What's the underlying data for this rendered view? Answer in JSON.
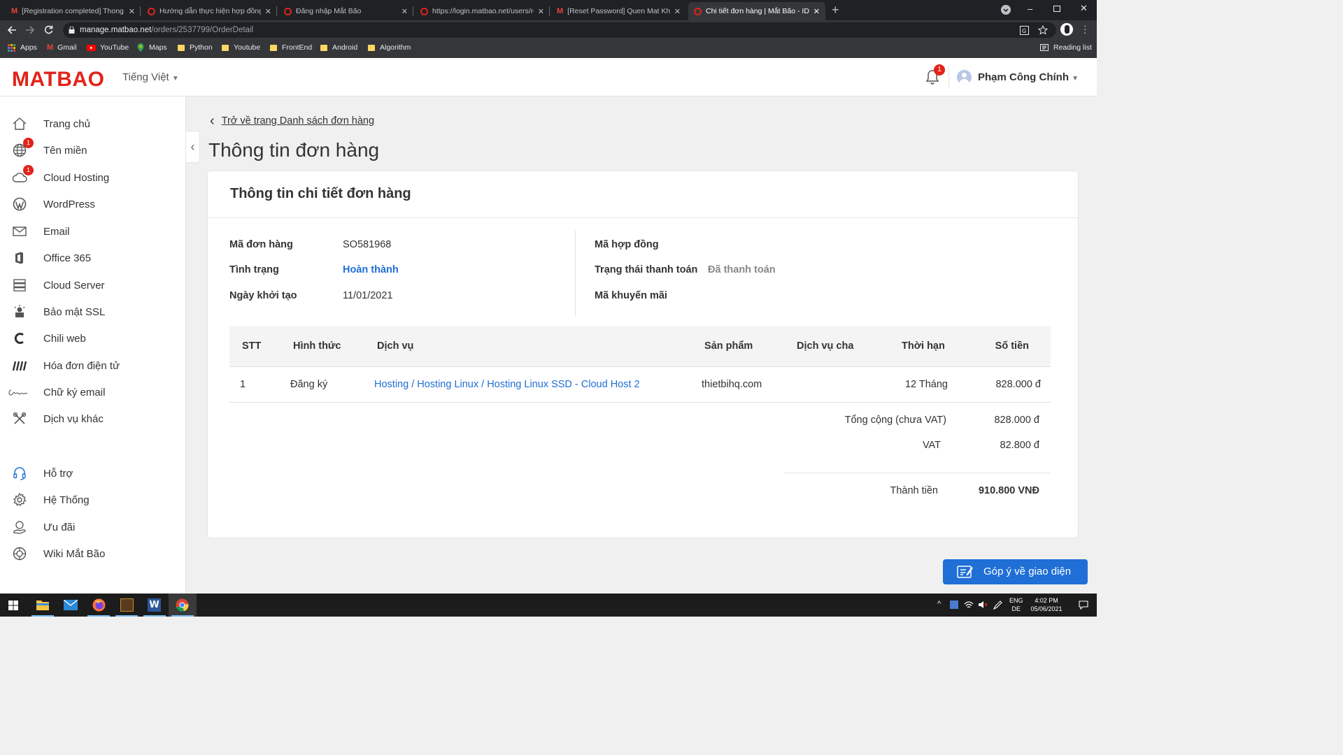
{
  "browser": {
    "tabs": [
      {
        "title": "[Registration completed] Thong",
        "favicon": "gmail-icon"
      },
      {
        "title": "Hướng dẫn thực hiện hợp đồng",
        "favicon": "opera-icon"
      },
      {
        "title": "Đăng nhập Mắt Bão",
        "favicon": "opera-icon"
      },
      {
        "title": "https://login.matbao.net/users/re",
        "favicon": "opera-icon"
      },
      {
        "title": "[Reset Password] Quen Mat Khau",
        "favicon": "gmail-icon"
      },
      {
        "title": "Chi tiết đơn hàng | Mắt Bão - ID",
        "favicon": "opera-icon",
        "active": true
      }
    ],
    "url_domain": "manage.matbao.net",
    "url_path": "/orders/2537799/OrderDetail",
    "bookmarks": [
      "Apps",
      "Gmail",
      "YouTube",
      "Maps",
      "Python",
      "Youtube",
      "FrontEnd",
      "Android",
      "Algorithm"
    ],
    "reading_list": "Reading list"
  },
  "header": {
    "logo": "MATBAO",
    "language": "Tiếng Việt",
    "notification_count": "1",
    "user_name": "Phạm Công Chính"
  },
  "sidebar": {
    "items": [
      {
        "label": "Trang chủ",
        "icon": "home-icon"
      },
      {
        "label": "Tên miền",
        "icon": "globe-icon",
        "badge": "1"
      },
      {
        "label": "Cloud Hosting",
        "icon": "cloud-icon",
        "badge": "1"
      },
      {
        "label": "WordPress",
        "icon": "wordpress-icon"
      },
      {
        "label": "Email",
        "icon": "envelope-icon"
      },
      {
        "label": "Office 365",
        "icon": "office-icon"
      },
      {
        "label": "Cloud Server",
        "icon": "server-icon"
      },
      {
        "label": "Bảo mật SSL",
        "icon": "ssl-icon"
      },
      {
        "label": "Chili web",
        "icon": "chili-icon"
      },
      {
        "label": "Hóa đơn điện tử",
        "icon": "invoice-icon"
      },
      {
        "label": "Chữ ký email",
        "icon": "signature-icon"
      },
      {
        "label": "Dịch vụ khác",
        "icon": "tools-icon"
      }
    ],
    "bottom_items": [
      {
        "label": "Hỗ trợ",
        "icon": "headset-icon"
      },
      {
        "label": "Hệ Thống",
        "icon": "gear-icon"
      },
      {
        "label": "Ưu đãi",
        "icon": "gift-icon"
      },
      {
        "label": "Wiki Mắt Bão",
        "icon": "wiki-icon"
      }
    ]
  },
  "main": {
    "back_link": "Trở về trang Danh sách đơn hàng",
    "page_title": "Thông tin đơn hàng",
    "card_title": "Thông tin chi tiết đơn hàng",
    "fields_left": [
      {
        "label": "Mã đơn hàng",
        "value": "SO581968"
      },
      {
        "label": "Tình trạng",
        "value": "Hoàn thành"
      },
      {
        "label": "Ngày khởi tạo",
        "value": "11/01/2021"
      }
    ],
    "fields_right": [
      {
        "label": "Mã hợp đồng",
        "value": ""
      },
      {
        "label": "Trạng thái thanh toán",
        "value": "Đã thanh toán"
      },
      {
        "label": "Mã khuyến mãi",
        "value": ""
      }
    ],
    "table": {
      "headers": [
        "STT",
        "Hình thức",
        "Dịch vụ",
        "Sản phẩm",
        "Dịch vụ cha",
        "Thời hạn",
        "Số tiền"
      ],
      "rows": [
        {
          "stt": "1",
          "type": "Đăng ký",
          "service": "Hosting / Hosting Linux / Hosting Linux SSD - Cloud Host 2",
          "product": "thietbihq.com",
          "parent": "",
          "term": "12 Tháng",
          "amount": "828.000 đ"
        }
      ]
    },
    "totals": {
      "subtotal_label": "Tổng cộng (chưa VAT)",
      "subtotal": "828.000 đ",
      "vat_label": "VAT",
      "vat": "82.800 đ",
      "total_label": "Thành tiền",
      "total": "910.800 VNĐ"
    },
    "feedback_button": "Góp ý về giao diện"
  },
  "taskbar": {
    "lang": "ENG",
    "lang_sub": "DE",
    "time": "4:02 PM",
    "date": "05/06/2021"
  },
  "colors": {
    "brand_red": "#e2231a",
    "link_blue": "#1f6fd6"
  }
}
